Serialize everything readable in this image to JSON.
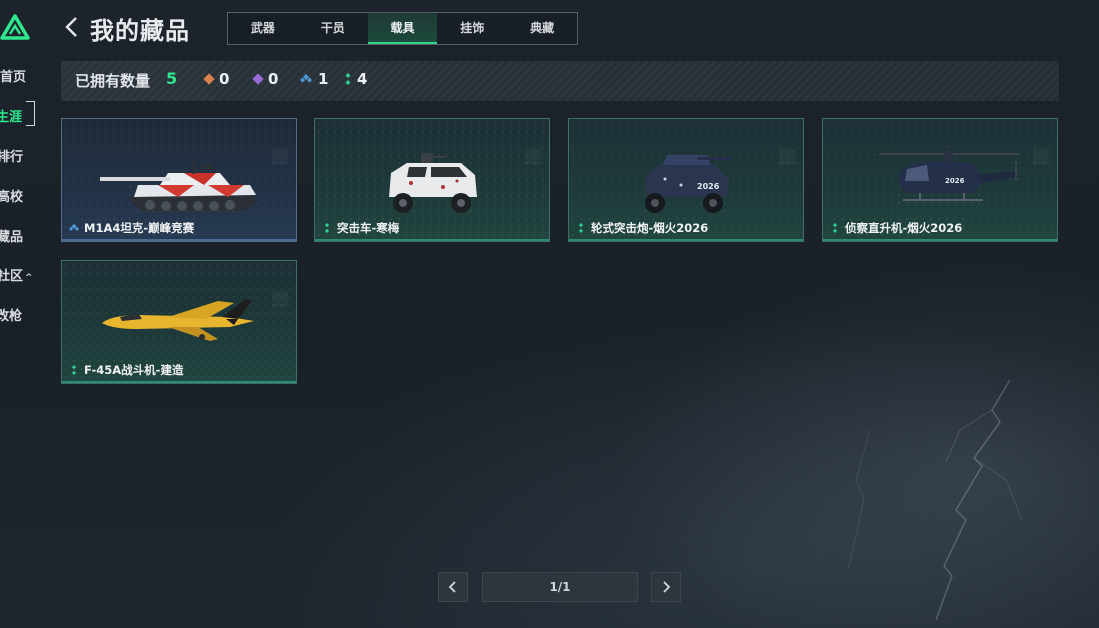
{
  "header": {
    "title": "我的藏品",
    "tabs": [
      {
        "label": "武器",
        "active": false
      },
      {
        "label": "干员",
        "active": false
      },
      {
        "label": "载具",
        "active": true
      },
      {
        "label": "挂饰",
        "active": false
      },
      {
        "label": "典藏",
        "active": false
      }
    ]
  },
  "sidebar": {
    "items": [
      {
        "label": "首页",
        "active": false
      },
      {
        "label": "生涯",
        "active": true
      },
      {
        "label": "排行",
        "active": false
      },
      {
        "label": "高校",
        "active": false
      },
      {
        "label": "藏品",
        "active": false
      },
      {
        "label": "社区",
        "active": false,
        "expandable": true
      },
      {
        "label": "改枪",
        "active": false
      }
    ]
  },
  "stats": {
    "owned_label": "已拥有数量",
    "owned_total": "5",
    "rarities": [
      {
        "icon": "orange-diamond-icon",
        "color": "#d9824a",
        "count": "0"
      },
      {
        "icon": "purple-diamond-icon",
        "color": "#9b6bd6",
        "count": "0"
      },
      {
        "icon": "blue-diamond-icon",
        "color": "#4f9bd8",
        "count": "1"
      },
      {
        "icon": "green-diamond-icon",
        "color": "#2ed192",
        "count": "4"
      }
    ]
  },
  "items": [
    {
      "name": "M1A4坦克-巅峰竞赛",
      "rarity": "blue",
      "vehicle": "tank-icon"
    },
    {
      "name": "突击车-寒梅",
      "rarity": "green",
      "vehicle": "assault-vehicle-icon"
    },
    {
      "name": "轮式突击炮-烟火2026",
      "rarity": "green",
      "vehicle": "wheeled-assault-gun-icon"
    },
    {
      "name": "侦察直升机-烟火2026",
      "rarity": "green",
      "vehicle": "helicopter-icon"
    },
    {
      "name": "F-45A战斗机-建造",
      "rarity": "green",
      "vehicle": "fighter-jet-icon"
    }
  ],
  "pagination": {
    "page": "1/1"
  },
  "colors": {
    "accent": "#2ee88f",
    "blue_rarity": "#4f9bd8",
    "green_rarity": "#2ed192"
  }
}
